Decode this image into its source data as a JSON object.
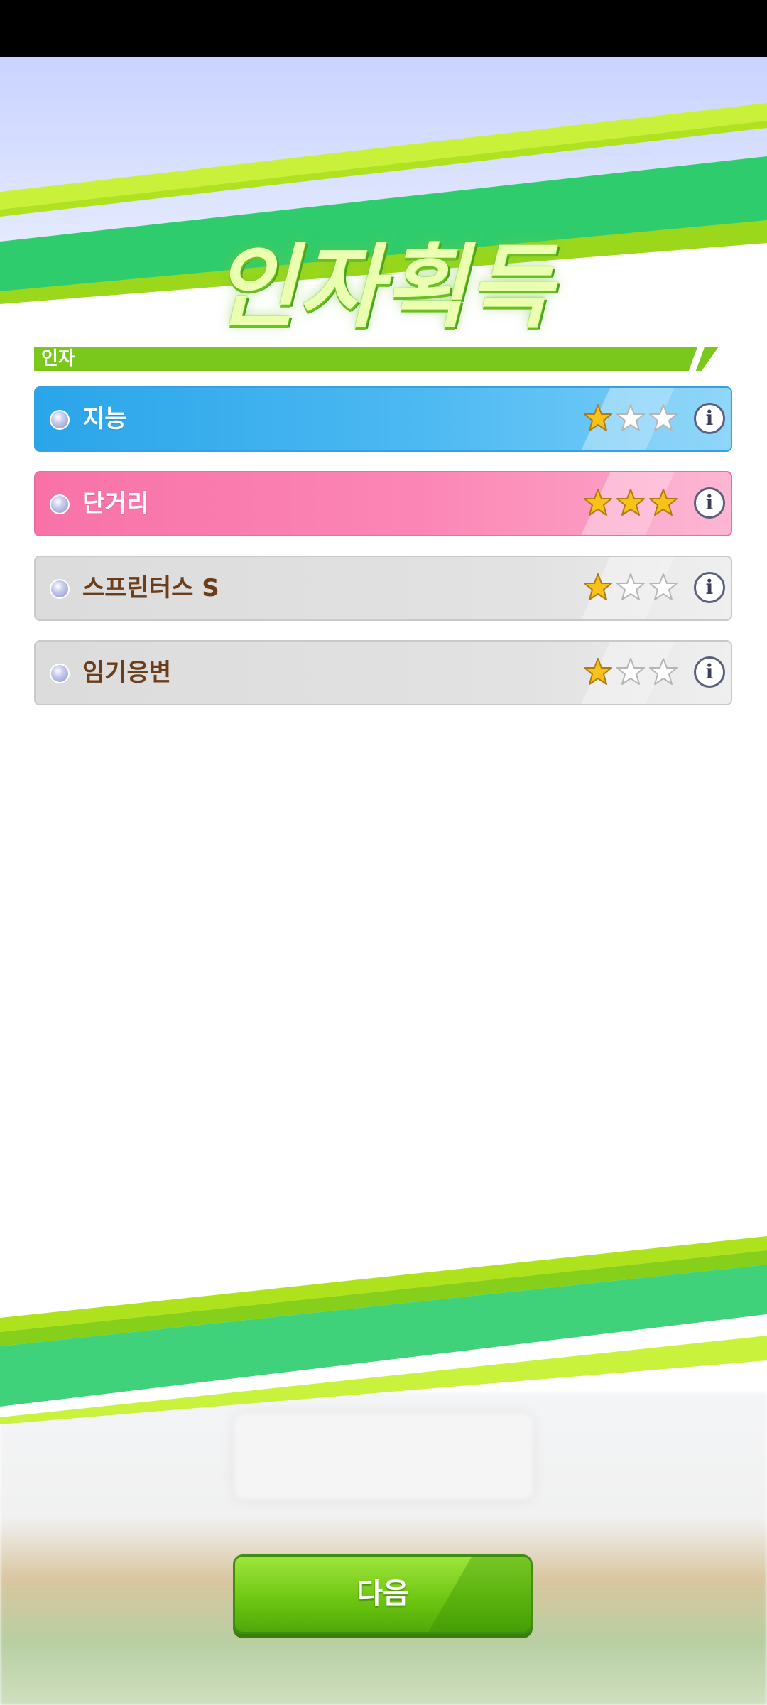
{
  "header": {
    "title": "인자획득"
  },
  "section": {
    "label": "인자"
  },
  "factors": [
    {
      "name": "지능",
      "stars": 1,
      "max_stars": 3,
      "color": "#3ab0ee"
    },
    {
      "name": "단거리",
      "stars": 3,
      "max_stars": 3,
      "color": "#f97bae"
    },
    {
      "name": "스프린터스 S",
      "stars": 1,
      "max_stars": 3,
      "color": "#dedede"
    },
    {
      "name": "임기응변",
      "stars": 1,
      "max_stars": 3,
      "color": "#dedede"
    }
  ],
  "info_glyph": "i",
  "footer": {
    "next_label": "다음"
  },
  "colors": {
    "accent_green": "#79c81b",
    "star_filled": "#f7c21a",
    "star_empty": "#ffffff"
  }
}
